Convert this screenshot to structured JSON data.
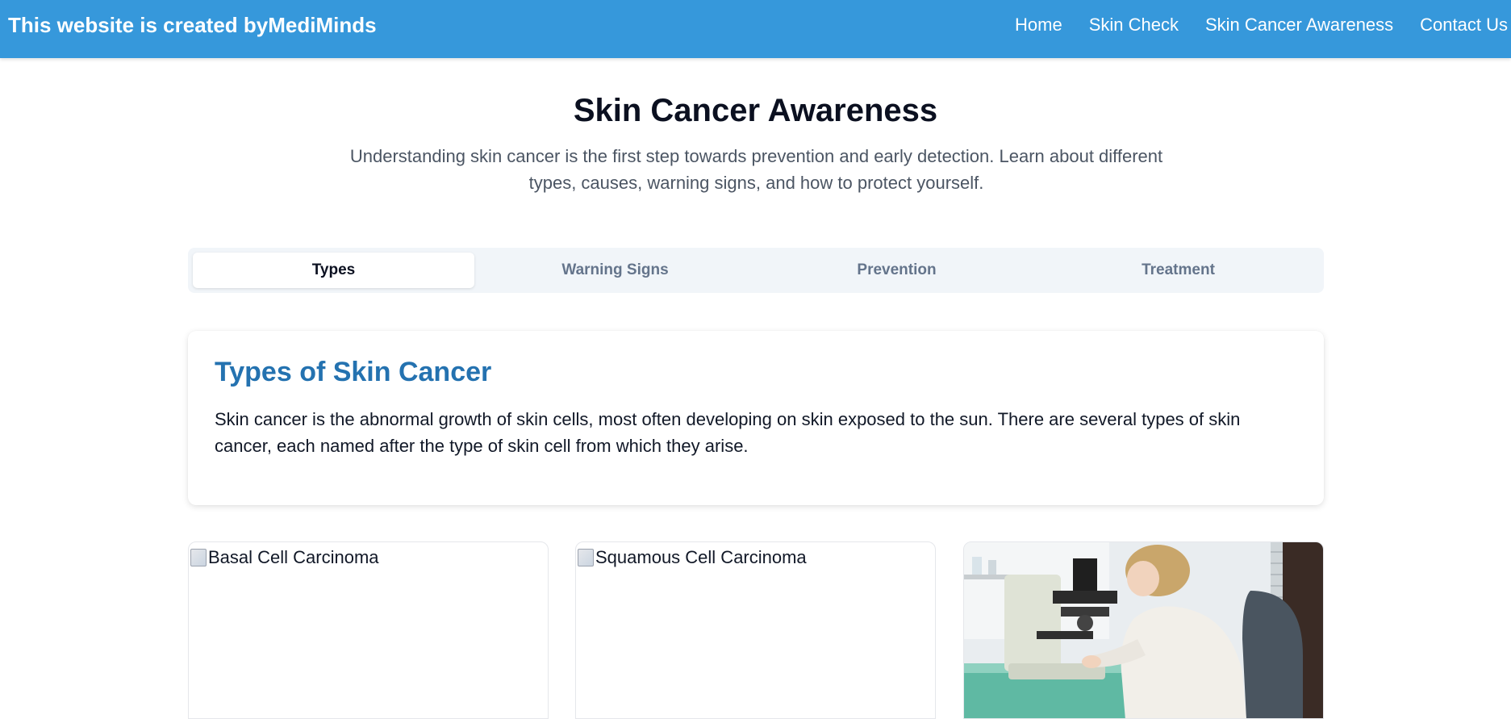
{
  "header": {
    "brand": "This website is created byMediMinds",
    "nav": [
      "Home",
      "Skin Check",
      "Skin Cancer Awareness",
      "Contact Us"
    ]
  },
  "hero": {
    "title": "Skin Cancer Awareness",
    "subtitle": "Understanding skin cancer is the first step towards prevention and early detection. Learn about different types, causes, warning signs, and how to protect yourself."
  },
  "tabs": [
    {
      "label": "Types",
      "active": true
    },
    {
      "label": "Warning Signs",
      "active": false
    },
    {
      "label": "Prevention",
      "active": false
    },
    {
      "label": "Treatment",
      "active": false
    }
  ],
  "info_card": {
    "title": "Types of Skin Cancer",
    "text": "Skin cancer is the abnormal growth of skin cells, most often developing on skin exposed to the sun. There are several types of skin cancer, each named after the type of skin cell from which they arise."
  },
  "cards": [
    {
      "alt": "Basal Cell Carcinoma"
    },
    {
      "alt": "Squamous Cell Carcinoma"
    }
  ],
  "colors": {
    "header_bg": "#3698db",
    "accent_title": "#2472b0",
    "tabs_bg": "#f1f5f9"
  }
}
